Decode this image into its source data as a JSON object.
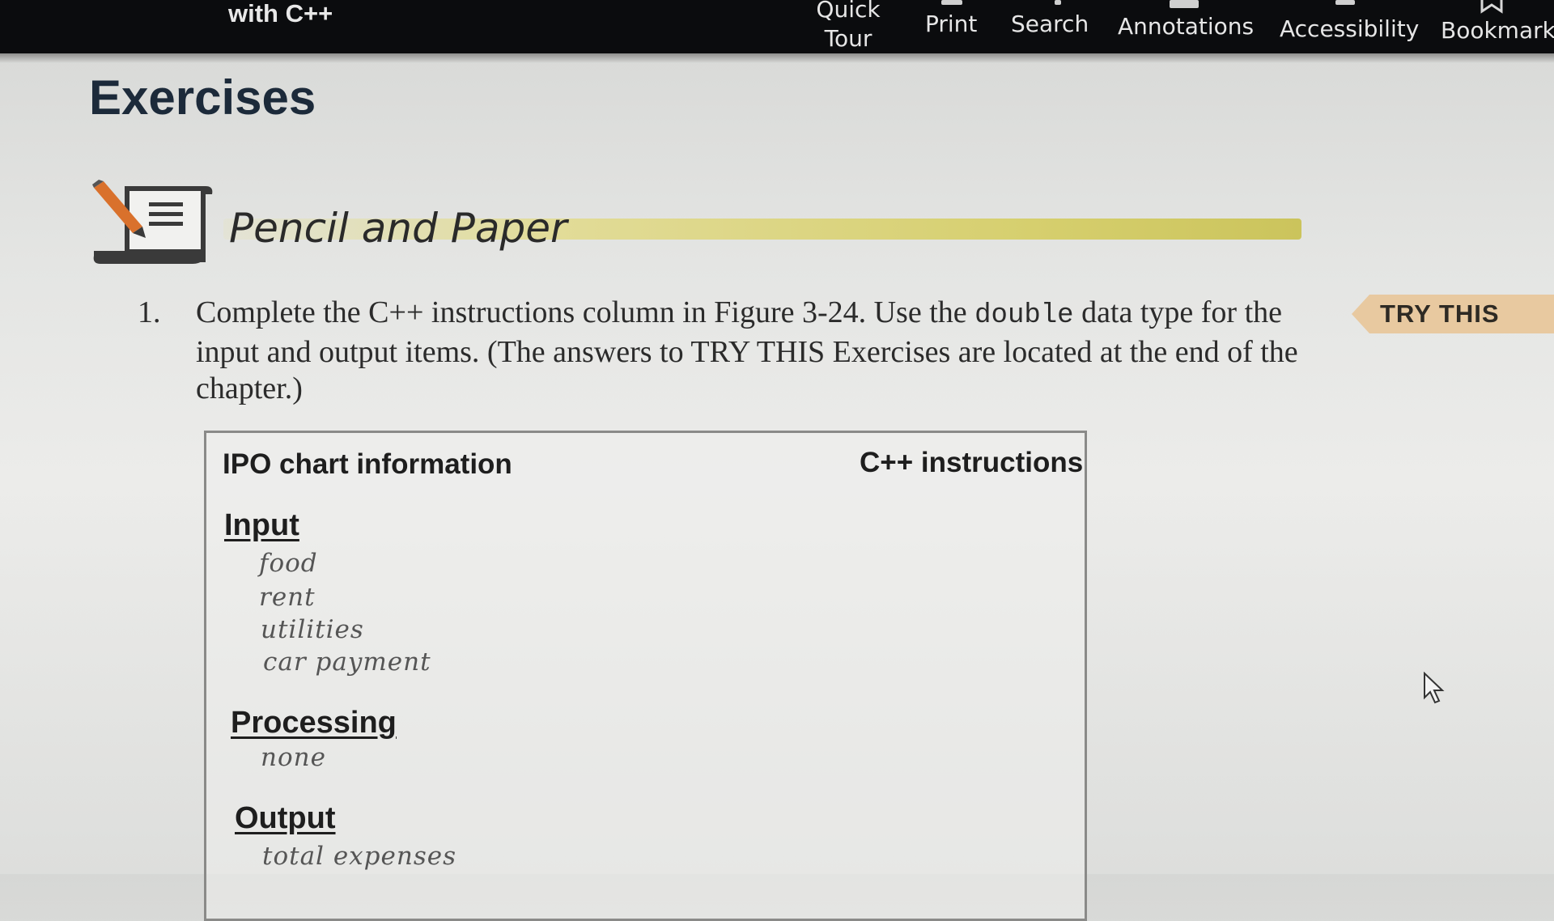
{
  "header": {
    "book_title": "with C++",
    "nav": [
      {
        "label_line1": "Quick",
        "label_line2": "Tour"
      },
      {
        "label": "Print"
      },
      {
        "label": "Search"
      },
      {
        "label": "Annotations"
      },
      {
        "label": "Accessibility"
      },
      {
        "label": "Bookmark"
      }
    ]
  },
  "page": {
    "title": "Exercises",
    "section_title": "Pencil and Paper",
    "question_number": "1.",
    "question_text_before": "Complete the C++ instructions column in Figure 3-24. Use the ",
    "question_code": "double",
    "question_text_after": " data type for the input and output items. (The answers to TRY THIS Exercises are located at the end of the chapter.)",
    "try_this_label": "TRY THIS"
  },
  "ipo_chart": {
    "col_left": "IPO chart information",
    "col_right": "C++ instructions",
    "input_heading": "Input",
    "input_items": [
      "food",
      "rent",
      "utilities",
      "car payment"
    ],
    "processing_heading": "Processing",
    "processing_items": [
      "none"
    ],
    "output_heading": "Output",
    "output_items": [
      "total expenses"
    ]
  },
  "colors": {
    "topbar": "#0b0c0e",
    "section_band": "#d6cf6e",
    "try_this_bg": "#e8c9a0",
    "heading_text": "#1c2a3a"
  },
  "icons": {
    "section_icon": "pencil-and-paper-icon",
    "cursor": "mouse-pointer-icon",
    "bookmark": "bookmark-icon"
  }
}
